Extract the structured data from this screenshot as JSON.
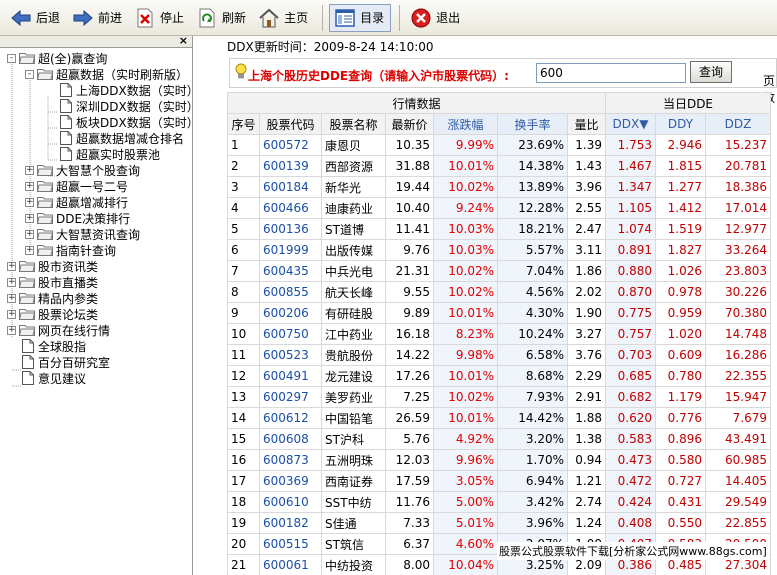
{
  "toolbar": {
    "back": "后退",
    "forward": "前进",
    "stop": "停止",
    "refresh": "刷新",
    "home": "主页",
    "catalog": "目录",
    "exit": "退出"
  },
  "tree": {
    "close": "×",
    "items": [
      {
        "label": "超(全)赢查询",
        "level": 0,
        "type": "folder",
        "exp": "-"
      },
      {
        "label": "超赢数据（实时刷新版）",
        "level": 1,
        "type": "folder",
        "exp": "-"
      },
      {
        "label": "上海DDX数据（实时）",
        "level": 2,
        "type": "doc"
      },
      {
        "label": "深圳DDX数据（实时）",
        "level": 2,
        "type": "doc"
      },
      {
        "label": "板块DDX数据（实时）",
        "level": 2,
        "type": "doc"
      },
      {
        "label": "超赢数据增减仓排名",
        "level": 2,
        "type": "doc"
      },
      {
        "label": "超赢实时股票池",
        "level": 2,
        "type": "doc"
      },
      {
        "label": "大智慧个股查询",
        "level": 1,
        "type": "folder",
        "exp": "+"
      },
      {
        "label": "超赢一号二号",
        "level": 1,
        "type": "folder",
        "exp": "+"
      },
      {
        "label": "超赢增减排行",
        "level": 1,
        "type": "folder",
        "exp": "+"
      },
      {
        "label": "DDE决策排行",
        "level": 1,
        "type": "folder",
        "exp": "+"
      },
      {
        "label": "大智慧资讯查询",
        "level": 1,
        "type": "folder",
        "exp": "+"
      },
      {
        "label": "指南针查询",
        "level": 1,
        "type": "folder",
        "exp": "+"
      },
      {
        "label": "股市资讯类",
        "level": 0,
        "type": "folder",
        "exp": "+"
      },
      {
        "label": "股市直播类",
        "level": 0,
        "type": "folder",
        "exp": "+"
      },
      {
        "label": "精品内参类",
        "level": 0,
        "type": "folder",
        "exp": "+"
      },
      {
        "label": "股票论坛类",
        "level": 0,
        "type": "folder",
        "exp": "+"
      },
      {
        "label": "网页在线行情",
        "level": 0,
        "type": "folder",
        "exp": "+"
      },
      {
        "label": "全球股指",
        "level": 0,
        "type": "doc"
      },
      {
        "label": "百分百研究室",
        "level": 0,
        "type": "doc"
      },
      {
        "label": "意见建议",
        "level": 0,
        "type": "doc"
      }
    ]
  },
  "main": {
    "ddx_time": "DDX更新时间：2009-8-24 14:10:00",
    "query_label": "上海个股历史DDE查询（请输入沪市股票代码）:",
    "query_value": "600",
    "query_button": "查询",
    "page_text": "页数",
    "group_market": "行情数据",
    "group_dde": "当日DDE",
    "columns": [
      "序号",
      "股票代码",
      "股票名称",
      "最新价",
      "涨跌幅",
      "换手率",
      "量比",
      "DDX▼",
      "DDY",
      "DDZ"
    ],
    "rows": [
      [
        "1",
        "600572",
        "康恩贝",
        "10.35",
        "9.99%",
        "23.69%",
        "1.39",
        "1.753",
        "2.946",
        "15.237"
      ],
      [
        "2",
        "600139",
        "西部资源",
        "31.88",
        "10.01%",
        "14.38%",
        "1.43",
        "1.467",
        "1.815",
        "20.781"
      ],
      [
        "3",
        "600184",
        "新华光",
        "19.44",
        "10.02%",
        "13.89%",
        "3.96",
        "1.347",
        "1.277",
        "18.386"
      ],
      [
        "4",
        "600466",
        "迪康药业",
        "10.40",
        "9.24%",
        "12.28%",
        "2.55",
        "1.105",
        "1.412",
        "17.014"
      ],
      [
        "5",
        "600136",
        "ST道博",
        "11.41",
        "10.03%",
        "18.21%",
        "2.47",
        "1.074",
        "1.519",
        "12.977"
      ],
      [
        "6",
        "601999",
        "出版传媒",
        "9.76",
        "10.03%",
        "5.57%",
        "3.11",
        "0.891",
        "1.827",
        "33.264"
      ],
      [
        "7",
        "600435",
        "中兵光电",
        "21.31",
        "10.02%",
        "7.04%",
        "1.86",
        "0.880",
        "1.026",
        "23.803"
      ],
      [
        "8",
        "600855",
        "航天长峰",
        "9.55",
        "10.02%",
        "4.56%",
        "2.02",
        "0.870",
        "0.978",
        "30.226"
      ],
      [
        "9",
        "600206",
        "有研硅股",
        "9.89",
        "10.01%",
        "4.30%",
        "1.90",
        "0.775",
        "0.959",
        "70.380"
      ],
      [
        "10",
        "600750",
        "江中药业",
        "16.18",
        "8.23%",
        "10.24%",
        "3.27",
        "0.757",
        "1.020",
        "14.748"
      ],
      [
        "11",
        "600523",
        "贵航股份",
        "14.22",
        "9.98%",
        "6.58%",
        "3.76",
        "0.703",
        "0.609",
        "16.286"
      ],
      [
        "12",
        "600491",
        "龙元建设",
        "17.26",
        "10.01%",
        "8.68%",
        "2.29",
        "0.685",
        "0.780",
        "22.355"
      ],
      [
        "13",
        "600297",
        "美罗药业",
        "7.25",
        "10.02%",
        "7.93%",
        "2.91",
        "0.682",
        "1.179",
        "15.947"
      ],
      [
        "14",
        "600612",
        "中国铅笔",
        "26.59",
        "10.01%",
        "14.42%",
        "1.88",
        "0.620",
        "0.776",
        "7.679"
      ],
      [
        "15",
        "600608",
        "ST沪科",
        "5.76",
        "4.92%",
        "3.20%",
        "1.38",
        "0.583",
        "0.896",
        "43.491"
      ],
      [
        "16",
        "600873",
        "五洲明珠",
        "12.03",
        "9.96%",
        "1.70%",
        "0.94",
        "0.473",
        "0.580",
        "60.985"
      ],
      [
        "17",
        "600369",
        "西南证券",
        "17.59",
        "3.05%",
        "6.94%",
        "1.21",
        "0.472",
        "0.727",
        "14.405"
      ],
      [
        "18",
        "600610",
        "SST中纺",
        "11.76",
        "5.00%",
        "3.42%",
        "2.74",
        "0.424",
        "0.431",
        "29.549"
      ],
      [
        "19",
        "600182",
        "S佳通",
        "7.33",
        "5.01%",
        "3.96%",
        "1.24",
        "0.408",
        "0.550",
        "22.855"
      ],
      [
        "20",
        "600515",
        "ST筑信",
        "6.37",
        "4.60%",
        "2.07%",
        "1.00",
        "0.407",
        "0.583",
        "20.500"
      ],
      [
        "21",
        "600061",
        "中纺投资",
        "8.00",
        "10.04%",
        "3.25%",
        "2.09",
        "0.386",
        "0.485",
        "27.304"
      ]
    ],
    "watermark": "股票公式股票软件下载[分析家公式网www.88gs.com]"
  }
}
